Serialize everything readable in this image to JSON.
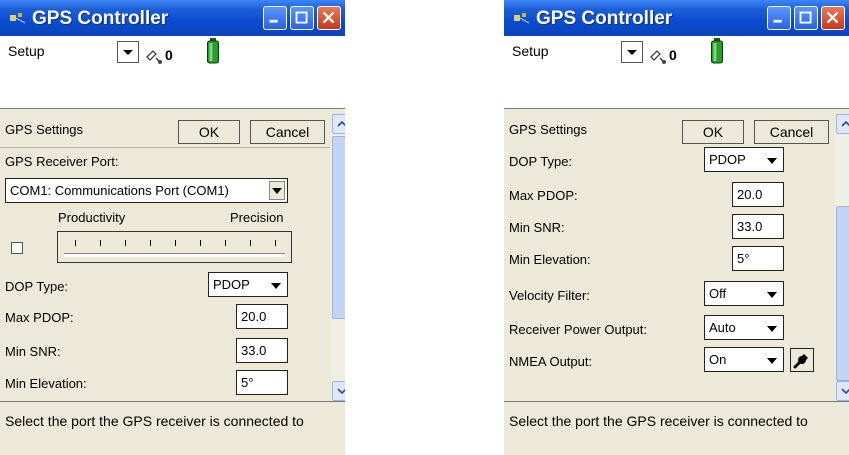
{
  "app": {
    "title": "GPS Controller"
  },
  "menu": {
    "setup_label": "Setup",
    "satellite_count": "0"
  },
  "panel": {
    "header": "GPS Settings",
    "ok_label": "OK",
    "cancel_label": "Cancel"
  },
  "left": {
    "receiver_port_label": "GPS Receiver Port:",
    "receiver_port_value": "COM1: Communications Port (COM1)",
    "productivity_label": "Productivity",
    "precision_label": "Precision",
    "dop_type_label": "DOP Type:",
    "dop_type_value": "PDOP",
    "max_pdop_label": "Max PDOP:",
    "max_pdop_value": "20.0",
    "min_snr_label": "Min SNR:",
    "min_snr_value": "33.0",
    "min_elevation_label": "Min Elevation:",
    "min_elevation_value": "5°"
  },
  "right": {
    "dop_type_label": "DOP Type:",
    "dop_type_value": "PDOP",
    "max_pdop_label": "Max PDOP:",
    "max_pdop_value": "20.0",
    "min_snr_label": "Min SNR:",
    "min_snr_value": "33.0",
    "min_elevation_label": "Min Elevation:",
    "min_elevation_value": "5°",
    "velocity_filter_label": "Velocity Filter:",
    "velocity_filter_value": "Off",
    "receiver_power_label": "Receiver Power Output:",
    "receiver_power_value": "Auto",
    "nmea_output_label": "NMEA Output:",
    "nmea_output_value": "On"
  },
  "status": {
    "text": "Select the port the GPS receiver is connected to"
  },
  "icons": {
    "app": "gps-app-icon",
    "satellite": "satellite-icon",
    "battery": "battery-icon",
    "wrench": "wrench-icon"
  },
  "colors": {
    "titlebar": "#0a4cd1",
    "close": "#c53a1a",
    "battery": "#2a9a2a"
  }
}
